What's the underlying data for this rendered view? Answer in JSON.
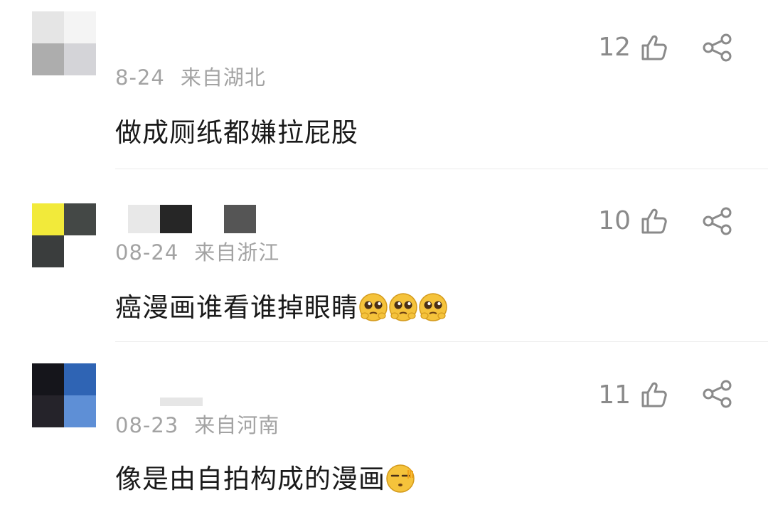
{
  "comments": [
    {
      "avatar_colors": [
        "#e5e5e5",
        "#f4f4f4",
        "#adadad",
        "#d4d4d8"
      ],
      "name_blur_colors": [
        "#ffffff"
      ],
      "date": "8-24",
      "location": "来自湖北",
      "text": "做成厕纸都嫌拉屁股",
      "emojis": [],
      "likes": "12"
    },
    {
      "avatar_colors": [
        "#f2ea3a",
        "#444846",
        "#3a3d3d",
        "#ffffff"
      ],
      "name_blur_colors": [
        "#e8e8e8",
        "#262626",
        "#ffffff",
        "#555555"
      ],
      "date": "08-24",
      "location": "来自浙江",
      "text": "癌漫画谁看谁掉眼睛",
      "emojis": [
        "pleading-face-emoji",
        "pleading-face-emoji",
        "pleading-face-emoji"
      ],
      "likes": "10"
    },
    {
      "avatar_colors": [
        "#15151b",
        "#2f64b4",
        "#25232a",
        "#5e8fd6"
      ],
      "name_blur_colors": [
        "#e6e6e6"
      ],
      "date": "08-23",
      "location": "来自河南",
      "text": "像是由自拍构成的漫画",
      "emojis": [
        "sleepy-face-emoji"
      ],
      "likes": "11"
    }
  ]
}
